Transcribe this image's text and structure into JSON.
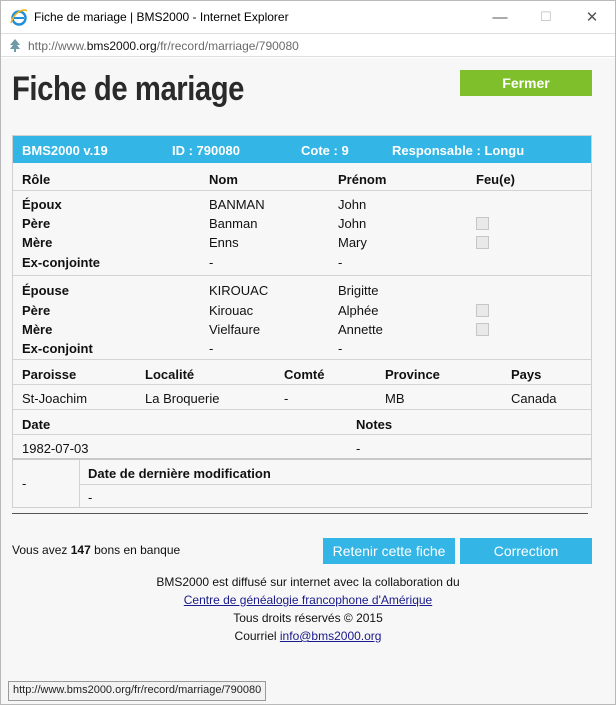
{
  "window": {
    "title": "Fiche de mariage | BMS2000 - Internet Explorer",
    "minimize": "—",
    "maximize": "☐",
    "close": "✕"
  },
  "address": {
    "url_prefix": "http://www.",
    "url_domain": "bms2000.org",
    "url_path": "/fr/record/marriage/790080"
  },
  "page": {
    "heading": "Fiche de mariage",
    "close_label": "Fermer"
  },
  "record": {
    "bar": {
      "version": "BMS2000 v.19",
      "id": "ID : 790080",
      "cote": "Cote : 9",
      "responsable": "Responsable : Longu"
    },
    "people_headers": {
      "role": "Rôle",
      "nom": "Nom",
      "prenom": "Prénom",
      "feu": "Feu(e)"
    },
    "groom": [
      {
        "role": "Époux",
        "nom": "BANMAN",
        "prenom": "John"
      },
      {
        "role": "Père",
        "nom": "Banman",
        "prenom": "John"
      },
      {
        "role": "Mère",
        "nom": "Enns",
        "prenom": "Mary"
      },
      {
        "role": "Ex-conjointe",
        "nom": "-",
        "prenom": "-"
      }
    ],
    "bride": [
      {
        "role": "Épouse",
        "nom": "KIROUAC",
        "prenom": "Brigitte"
      },
      {
        "role": "Père",
        "nom": "Kirouac",
        "prenom": "Alphée"
      },
      {
        "role": "Mère",
        "nom": "Vielfaure",
        "prenom": "Annette"
      },
      {
        "role": "Ex-conjoint",
        "nom": "-",
        "prenom": "-"
      }
    ],
    "place_headers": {
      "paroisse": "Paroisse",
      "localite": "Localité",
      "comte": "Comté",
      "province": "Province",
      "pays": "Pays"
    },
    "place": {
      "paroisse": "St-Joachim",
      "localite": "La Broquerie",
      "comte": "-",
      "province": "MB",
      "pays": "Canada"
    },
    "date_headers": {
      "date": "Date",
      "notes": "Notes"
    },
    "date": {
      "date": "1982-07-03",
      "notes": "-"
    },
    "modif": {
      "left": "-",
      "header": "Date de dernière modification",
      "value": "-"
    }
  },
  "bank": {
    "prefix": "Vous avez",
    "count": "147",
    "suffix": "bons en banque"
  },
  "buttons": {
    "retain": "Retenir cette fiche",
    "correction": "Correction"
  },
  "footer": {
    "line1": "BMS2000 est diffusé sur internet avec la collaboration du",
    "link": "Centre de généalogie francophone d'Amérique",
    "rights": "Tous droits réservés © 2015",
    "mail_label": "Courriel",
    "mail": "info@bms2000.org"
  },
  "status_url": "http://www.bms2000.org/fr/record/marriage/790080",
  "colors": {
    "accent_blue": "#33b5e5",
    "accent_green": "#7fbf2b"
  }
}
